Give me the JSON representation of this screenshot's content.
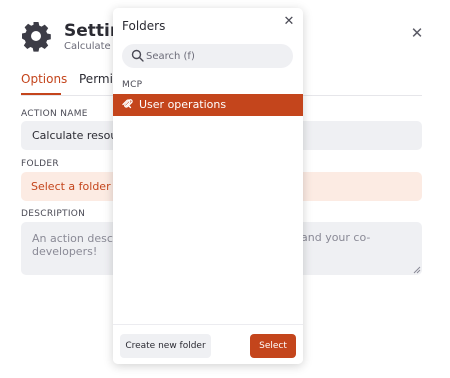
{
  "settings": {
    "title": "Setting",
    "subtitle": "Calculate re",
    "close_icon": "close-icon",
    "tabs": [
      {
        "label": "Options",
        "active": true
      },
      {
        "label": "Permiss",
        "active": false
      }
    ],
    "fields": {
      "action_name_label": "ACTION NAME",
      "action_name_value": "Calculate resourc",
      "folder_label": "FOLDER",
      "folder_value": "Select a folder",
      "description_label": "DESCRIPTION",
      "description_placeholder_left": "An action descrip",
      "description_placeholder_right": "and your co-",
      "description_placeholder_line2": "developers!"
    }
  },
  "folders_popup": {
    "title": "Folders",
    "search_placeholder": "Search (f)",
    "section_label": "MCP",
    "items": [
      {
        "label": "User operations",
        "selected": true,
        "icon": "mcp-icon"
      }
    ],
    "create_button": "Create new folder",
    "select_button": "Select"
  },
  "colors": {
    "accent": "#c4451c",
    "field_bg": "#eff0f3",
    "folder_field_bg": "#fcebe3"
  }
}
